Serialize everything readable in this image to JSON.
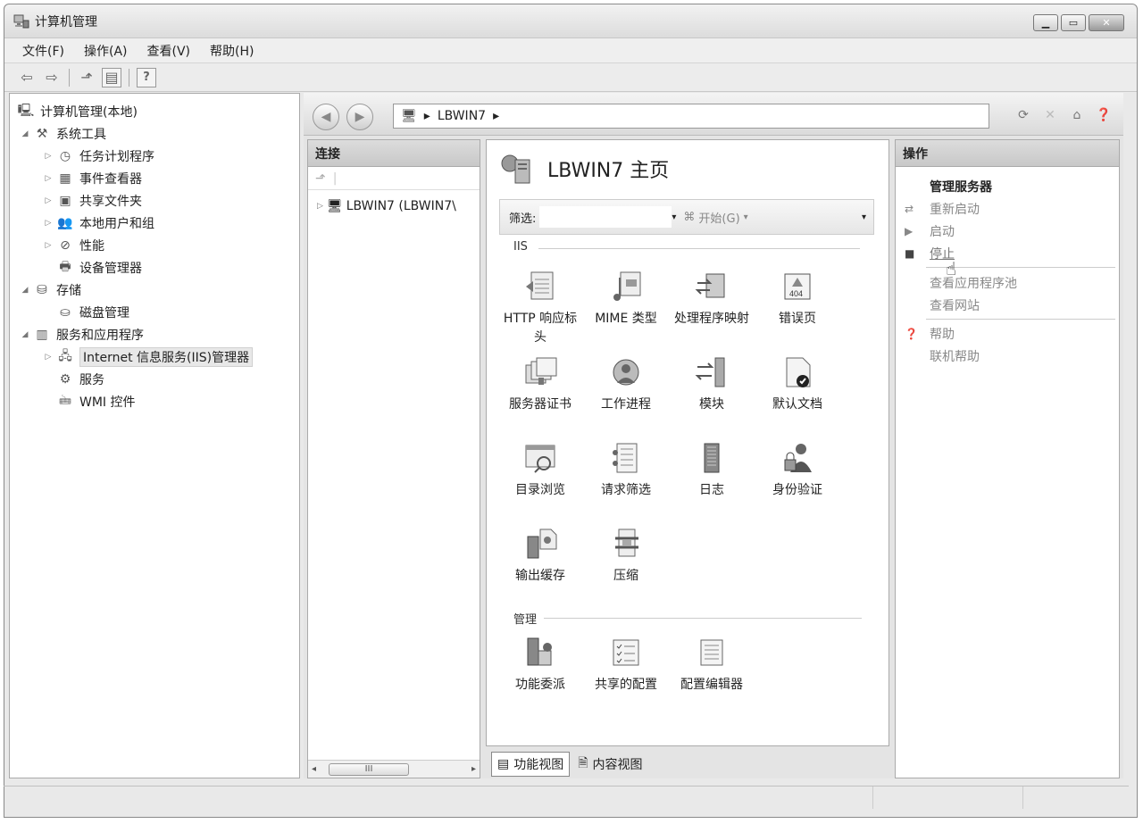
{
  "window": {
    "title": "计算机管理"
  },
  "menu": [
    "文件(F)",
    "操作(A)",
    "查看(V)",
    "帮助(H)"
  ],
  "tree": {
    "root": "计算机管理(本地)",
    "items": [
      {
        "label": "系统工具",
        "arrow": "◢"
      },
      {
        "label": "任务计划程序",
        "arrow": "▷"
      },
      {
        "label": "事件查看器",
        "arrow": "▷"
      },
      {
        "label": "共享文件夹",
        "arrow": "▷"
      },
      {
        "label": "本地用户和组",
        "arrow": "▷"
      },
      {
        "label": "性能",
        "arrow": "▷"
      },
      {
        "label": "设备管理器",
        "arrow": ""
      },
      {
        "label": "存储",
        "arrow": "◢"
      },
      {
        "label": "磁盘管理",
        "arrow": ""
      },
      {
        "label": "服务和应用程序",
        "arrow": "◢"
      },
      {
        "label": "Internet 信息服务(IIS)管理器",
        "arrow": "▷"
      },
      {
        "label": "服务",
        "arrow": ""
      },
      {
        "label": "WMI 控件",
        "arrow": ""
      }
    ]
  },
  "address": {
    "path": "LBWIN7",
    "sep": "▸"
  },
  "connections": {
    "header": "连接",
    "node": "LBWIN7 (LBWIN7\\",
    "scroll_thumb": "III"
  },
  "home": {
    "title": "LBWIN7 主页",
    "filter_label": "筛选:",
    "go_label": "开始(G)",
    "groups": {
      "iis": "IIS",
      "manage": "管理"
    },
    "features": [
      "HTTP 响应标头",
      "MIME 类型",
      "处理程序映射",
      "错误页",
      "服务器证书",
      "工作进程",
      "模块",
      "默认文档",
      "目录浏览",
      "请求筛选",
      "日志",
      "身份验证",
      "输出缓存",
      "压缩",
      "功能委派",
      "共享的配置",
      "配置编辑器"
    ]
  },
  "view_tabs": [
    "功能视图",
    "内容视图"
  ],
  "actions": {
    "header": "操作",
    "manage_server": "管理服务器",
    "restart": "重新启动",
    "start": "启动",
    "stop": "停止",
    "view_app_pools": "查看应用程序池",
    "view_sites": "查看网站",
    "help": "帮助",
    "online_help": "联机帮助"
  }
}
